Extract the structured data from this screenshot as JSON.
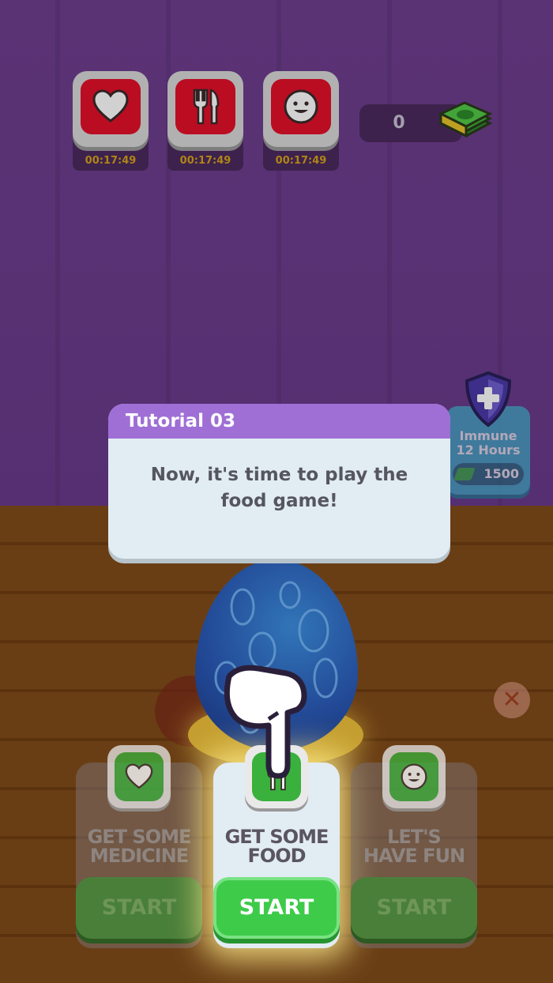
{
  "stats": [
    {
      "icon": "heart-icon",
      "timer": "00:17:49"
    },
    {
      "icon": "fork-knife-icon",
      "timer": "00:17:49"
    },
    {
      "icon": "smiley-icon",
      "timer": "00:17:49"
    }
  ],
  "money": {
    "value": "0",
    "icon": "cash-stack-icon"
  },
  "immune": {
    "line1": "Immune",
    "line2": "12 Hours",
    "price": "1500",
    "icon": "shield-plus-icon"
  },
  "tutorial": {
    "title": "Tutorial 03",
    "message_line1": "Now, it's time to play the",
    "message_line2": "food game!"
  },
  "close": {
    "icon": "close-icon"
  },
  "activities": [
    {
      "title_line1": "GET SOME",
      "title_line2": "MEDICINE",
      "start_label": "START",
      "icon": "heart-icon",
      "active": false
    },
    {
      "title_line1": "GET SOME",
      "title_line2": "FOOD",
      "start_label": "START",
      "icon": "fork-knife-icon",
      "active": true
    },
    {
      "title_line1": "LET'S",
      "title_line2": "HAVE FUN",
      "start_label": "START",
      "icon": "smiley-icon",
      "active": false
    }
  ],
  "colors": {
    "wall": "#6a3a8c",
    "tutorial_header": "#9f6fd6",
    "start_active": "#3ecb4a",
    "stat_red": "#e3102a",
    "timer": "#d6a21d"
  }
}
